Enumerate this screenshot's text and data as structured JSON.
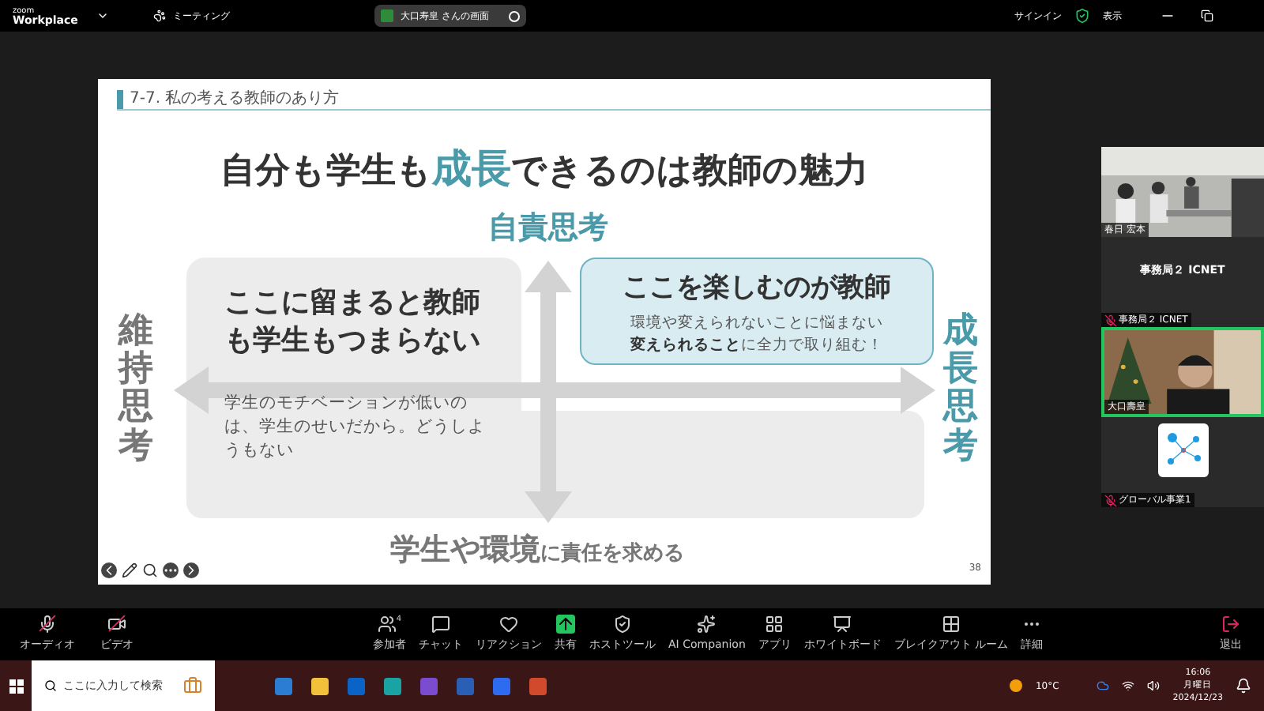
{
  "topbar": {
    "logo_small": "zoom",
    "logo": "Workplace",
    "meeting": "ミーティング",
    "share_title": "大口寿皇 さんの画面",
    "sign_in": "サインイン",
    "view": "表示"
  },
  "slide": {
    "header": "7-7. 私の考える教師のあり方",
    "title": [
      {
        "text": "自分も学生も",
        "accent": false
      },
      {
        "text": "成長",
        "accent": true
      },
      {
        "text": "できるのは教師の魅力",
        "accent": false
      }
    ],
    "top_label": "自責思考",
    "left_label": "維持思考",
    "right_label": "成長思考",
    "left_box": {
      "title": "ここに留まると教師も学生もつまらない",
      "body": "学生のモチベーションが低いのは、学生のせいだから。どうしようもない"
    },
    "right_box": {
      "title": "ここを楽しむのが教師",
      "body": "環境や変えられないことに悩まない",
      "body2": "**変えられること**に全力で取り組む！"
    },
    "bottom_label": [
      {
        "text": "学生や環境",
        "large": true
      },
      {
        "text": "に責任を求める",
        "large": false
      }
    ],
    "page": "38"
  },
  "participants": [
    {
      "kind": "video",
      "name": "春日 宏本",
      "muted": false,
      "active": false
    },
    {
      "kind": "name",
      "display": "事務局２ ICNET",
      "name": "事務局２ ICNET",
      "muted": true,
      "active": false
    },
    {
      "kind": "video",
      "name": "大口壽皇",
      "muted": false,
      "active": true
    },
    {
      "kind": "logo",
      "name": "グローバル事業1",
      "muted": true,
      "active": false
    }
  ],
  "toolbar": {
    "left": [
      {
        "label": "オーディオ",
        "muted": true
      },
      {
        "label": "ビデオ",
        "muted": true
      }
    ],
    "center": [
      {
        "label": "参加者",
        "count": "4"
      },
      {
        "label": "チャット"
      },
      {
        "label": "リアクション"
      },
      {
        "label": "共有"
      },
      {
        "label": "ホストツール"
      },
      {
        "label": "AI Companion"
      },
      {
        "label": "アプリ"
      },
      {
        "label": "ホワイトボード"
      },
      {
        "label": "ブレイクアウト ルーム"
      },
      {
        "label": "詳細"
      }
    ],
    "leave": "退出"
  },
  "taskbar": {
    "search_placeholder": "ここに入力して検索",
    "weather": "10°C",
    "time": "16:06",
    "day": "月曜日",
    "date": "2024/12/23"
  }
}
